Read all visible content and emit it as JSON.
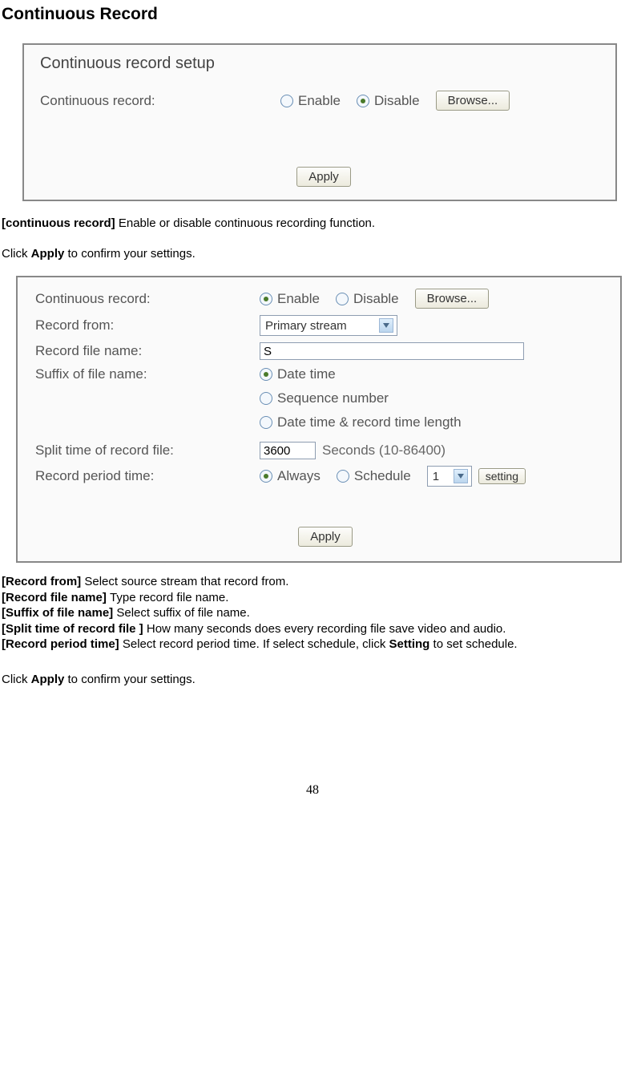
{
  "title": "Continuous Record",
  "panel1": {
    "heading": "Continuous record setup",
    "label_continuous": "Continuous record:",
    "enable": "Enable",
    "disable": "Disable",
    "browse": "Browse...",
    "apply": "Apply"
  },
  "desc1_label": "[continuous record] ",
  "desc1_text": "Enable or disable continuous recording function.",
  "apply_sentence_prefix": "Click ",
  "apply_sentence_bold": "Apply",
  "apply_sentence_suffix": " to confirm your settings.",
  "panel2": {
    "label_continuous": "Continuous record:",
    "enable": "Enable",
    "disable": "Disable",
    "browse": "Browse...",
    "label_record_from": "Record from:",
    "record_from_value": "Primary stream",
    "label_file_name": "Record file name:",
    "file_name_value": "S",
    "label_suffix": "Suffix of file name:",
    "suffix_options": {
      "datetime": "Date time",
      "sequence": "Sequence number",
      "datetime_length": "Date time & record time length"
    },
    "label_split": "Split time of record file:",
    "split_value": "3600",
    "split_unit": "Seconds (10-86400)",
    "label_period": "Record period time:",
    "period_always": "Always",
    "period_schedule": "Schedule",
    "schedule_select": "1",
    "setting_btn": "setting",
    "apply": "Apply"
  },
  "desc2": {
    "l1_label": "[Record from] ",
    "l1_text": "Select source stream that record from.",
    "l2_label": "[Record file name] ",
    "l2_text": "Type record file name.",
    "l3_label": "[Suffix of file name] ",
    "l3_text": "Select suffix of file name.",
    "l4_label": "[Split time of record file ] ",
    "l4_text": "How many seconds does every recording file save video and audio.",
    "l5_label": "[Record period time] ",
    "l5_text_a": "Select record period time. If select schedule, click ",
    "l5_bold": "Setting",
    "l5_text_b": " to set schedule."
  },
  "page_number": "48"
}
